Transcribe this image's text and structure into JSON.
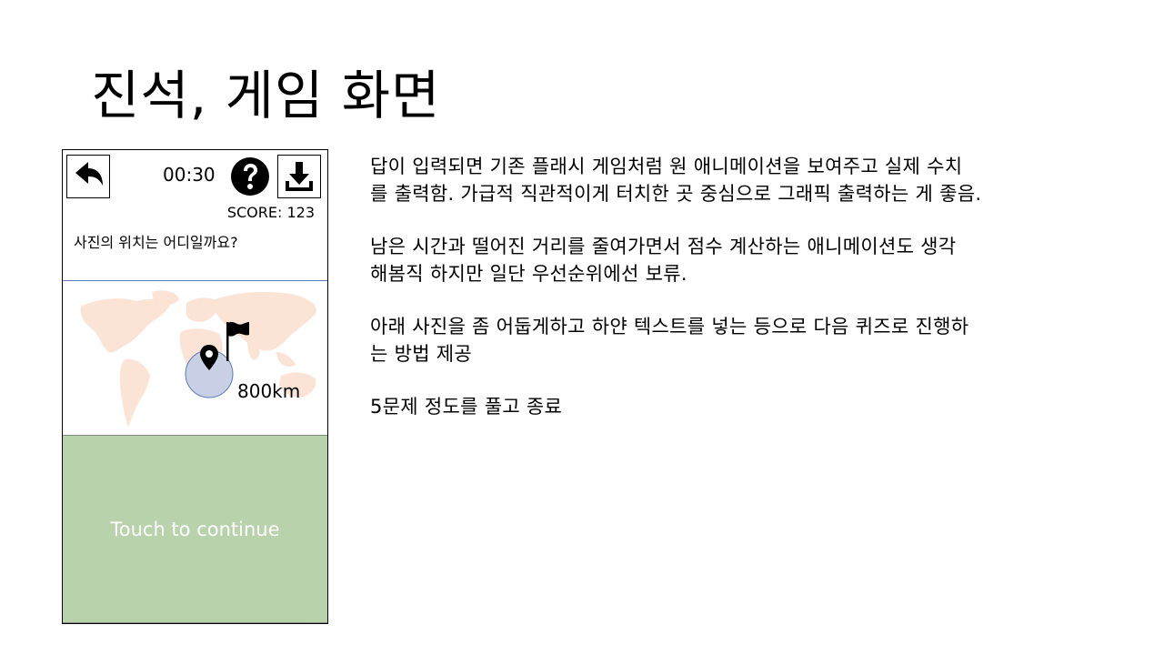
{
  "slide": {
    "title": "진석, 게임 화면"
  },
  "phone": {
    "timer": "00:30",
    "score": "SCORE: 123",
    "question": "사진의 위치는 어디일까요?",
    "icons": {
      "back": "back-arrow-icon",
      "help": "question-circle-icon",
      "download": "download-icon",
      "flag": "flag-icon",
      "pin": "map-pin-icon"
    },
    "map": {
      "continent_color": "#fbe3d5",
      "guess_circle_color": "#c9d0e6",
      "distance_label": "800km"
    },
    "continue": {
      "label": "Touch to continue",
      "bg_color": "#b8d3ab"
    }
  },
  "notes": [
    "답이 입력되면 기존 플래시 게임처럼 원 애니메이션을 보여주고 실제 수치\n를 출력함. 가급적 직관적이게 터치한 곳 중심으로 그래픽 출력하는 게 좋음.",
    "남은 시간과 떨어진 거리를 줄여가면서 점수 계산하는 애니메이션도 생각\n해봄직 하지만 일단 우선순위에선 보류.",
    "아래 사진을 좀 어둡게하고 하얀 텍스트를 넣는 등으로 다음 퀴즈로 진행하\n는 방법 제공",
    "5문제 정도를 풀고 종료"
  ]
}
